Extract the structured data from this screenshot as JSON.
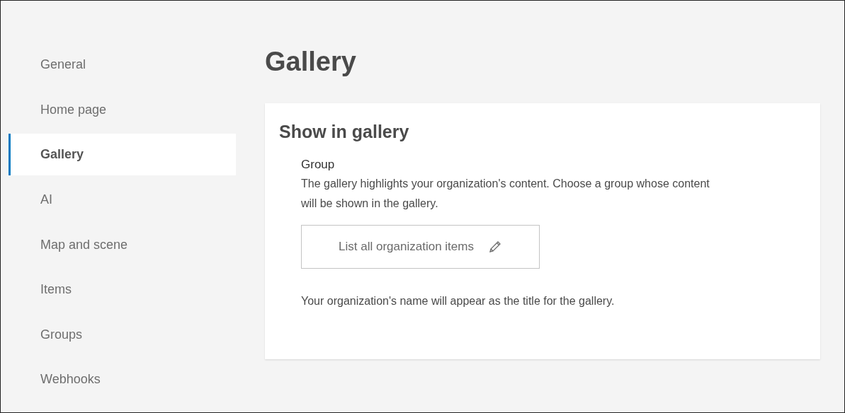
{
  "sidebar": {
    "items": [
      {
        "label": "General",
        "selected": false
      },
      {
        "label": "Home page",
        "selected": false
      },
      {
        "label": "Gallery",
        "selected": true
      },
      {
        "label": "AI",
        "selected": false
      },
      {
        "label": "Map and scene",
        "selected": false
      },
      {
        "label": "Items",
        "selected": false
      },
      {
        "label": "Groups",
        "selected": false
      },
      {
        "label": "Webhooks",
        "selected": false
      }
    ]
  },
  "page_title": "Gallery",
  "card": {
    "title": "Show in gallery",
    "field_label": "Group",
    "description": "The gallery highlights your organization's content. Choose a group whose content will be shown in the gallery.",
    "group_button": "List all organization items",
    "note": "Your organization's name will appear as the title for the gallery."
  }
}
